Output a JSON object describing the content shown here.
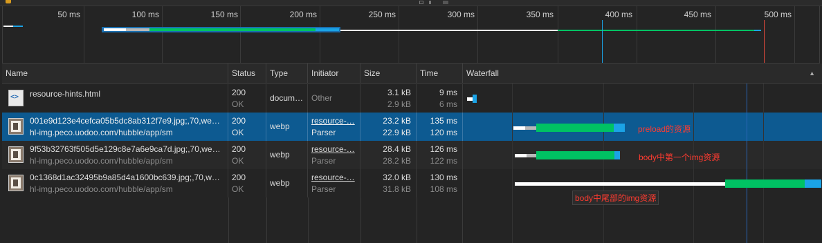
{
  "overview": {
    "ticks": [
      "50 ms",
      "100 ms",
      "150 ms",
      "200 ms",
      "250 ms",
      "300 ms",
      "350 ms",
      "400 ms",
      "450 ms",
      "500 ms"
    ]
  },
  "columns": {
    "name": "Name",
    "status": "Status",
    "type": "Type",
    "initiator": "Initiator",
    "size": "Size",
    "time": "Time",
    "waterfall": "Waterfall",
    "sort_indicator": "▲"
  },
  "rows": [
    {
      "name": "resource-hints.html",
      "domain": "",
      "status": "200",
      "status_text": "OK",
      "type": "docum…",
      "initiator": "Other",
      "initiator_sub": "",
      "size": "3.1 kB",
      "size_sub": "2.9 kB",
      "time": "9 ms",
      "time_sub": "6 ms",
      "icon": "html-document-icon"
    },
    {
      "name": "001e9d123e4cefca05b5dc8ab312f7e9.jpg;,70,we…",
      "domain": "hl-img.peco.uodoo.com/hubble/app/sm",
      "status": "200",
      "status_text": "OK",
      "type": "webp",
      "initiator": "resource-…",
      "initiator_sub": "Parser",
      "size": "23.2 kB",
      "size_sub": "22.9 kB",
      "time": "135 ms",
      "time_sub": "120 ms",
      "icon": "image-thumbnail-icon"
    },
    {
      "name": "9f53b32763f505d5e129c8e7a6e9ca7d.jpg;,70,we…",
      "domain": "hl-img.peco.uodoo.com/hubble/app/sm",
      "status": "200",
      "status_text": "OK",
      "type": "webp",
      "initiator": "resource-…",
      "initiator_sub": "Parser",
      "size": "28.4 kB",
      "size_sub": "28.2 kB",
      "time": "126 ms",
      "time_sub": "122 ms",
      "icon": "image-thumbnail-icon"
    },
    {
      "name": "0c1368d1ac32495b9a85d4a1600bc639.jpg;,70,w…",
      "domain": "hl-img.peco.uodoo.com/hubble/app/sm",
      "status": "200",
      "status_text": "OK",
      "type": "webp",
      "initiator": "resource-…",
      "initiator_sub": "Parser",
      "size": "32.0 kB",
      "size_sub": "31.8 kB",
      "time": "130 ms",
      "time_sub": "108 ms",
      "icon": "image-thumbnail-icon"
    }
  ],
  "annotations": {
    "preload": "preload的资源",
    "first_img": "body中第一个img资源",
    "tail_img": "body中尾部的img资源"
  },
  "colors": {
    "waiting": "#00c263",
    "download": "#1ba3e6",
    "queue": "#b8b8b8",
    "stalled": "#ffffff",
    "dom_content_loaded": "#1f78d1",
    "load": "#e2493c",
    "selected_row": "#0d5a91",
    "annotation": "#ff3b30"
  }
}
